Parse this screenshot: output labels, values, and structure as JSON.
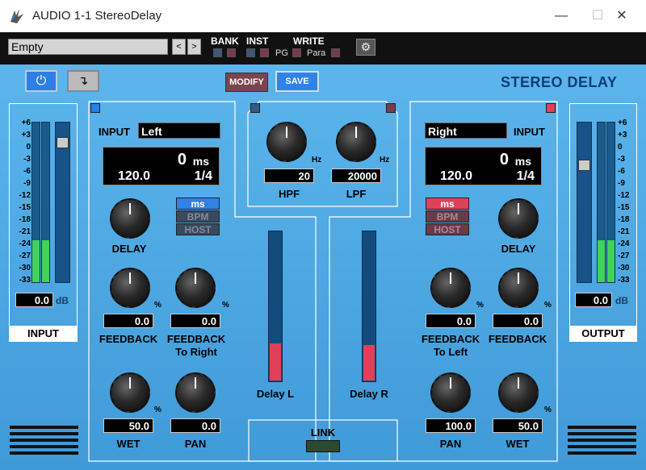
{
  "window": {
    "title": "AUDIO 1-1 StereoDelay",
    "minimize": "—",
    "maximize": "☐",
    "close": "✕"
  },
  "toolbar": {
    "preset": "Empty",
    "prev": "<",
    "next": ">",
    "bank": "BANK",
    "inst": "INST",
    "write": "WRITE",
    "pg": "PG",
    "para": "Para"
  },
  "controls": {
    "modify": "MODIFY",
    "save": "SAVE"
  },
  "plugin_title": "STEREO DELAY",
  "input_meter": {
    "scale": [
      "+6",
      "+3",
      "0",
      "-3",
      "-6",
      "-9",
      "-12",
      "-15",
      "-18",
      "-21",
      "-24",
      "-27",
      "-30",
      "-33"
    ],
    "value": "0.0",
    "unit": "dB",
    "label": "INPUT"
  },
  "output_meter": {
    "scale": [
      "+6",
      "+3",
      "0",
      "-3",
      "-6",
      "-9",
      "-12",
      "-15",
      "-18",
      "-21",
      "-24",
      "-27",
      "-30",
      "-33"
    ],
    "value": "0.0",
    "unit": "dB",
    "label": "OUTPUT"
  },
  "left": {
    "input_label": "INPUT",
    "input_value": "Left",
    "ms_value": "0",
    "ms_unit": "ms",
    "bpm_value": "120.0",
    "note": "1/4",
    "mode": [
      "ms",
      "BPM",
      "HOST"
    ],
    "delay_label": "DELAY",
    "feedback_value": "0.0",
    "feedback_label": "FEEDBACK",
    "cross_value": "0.0",
    "cross_label": "FEEDBACK",
    "cross_label2": "To Right",
    "wet_value": "50.0",
    "wet_label": "WET",
    "pan_value": "0.0",
    "pan_label": "PAN",
    "pct": "%",
    "fader_label": "Delay L"
  },
  "right": {
    "input_label": "INPUT",
    "input_value": "Right",
    "ms_value": "0",
    "ms_unit": "ms",
    "bpm_value": "120.0",
    "note": "1/4",
    "mode": [
      "ms",
      "BPM",
      "HOST"
    ],
    "delay_label": "DELAY",
    "cross_value": "0.0",
    "cross_label": "FEEDBACK",
    "cross_label2": "To Left",
    "feedback_value": "0.0",
    "feedback_label": "FEEDBACK",
    "pan_value": "100.0",
    "pan_label": "PAN",
    "wet_value": "50.0",
    "wet_label": "WET",
    "pct": "%",
    "fader_label": "Delay R"
  },
  "filter": {
    "hpf_value": "20",
    "hpf_label": "HPF",
    "lpf_value": "20000",
    "lpf_label": "LPF",
    "unit": "Hz"
  },
  "link": {
    "label": "LINK"
  }
}
